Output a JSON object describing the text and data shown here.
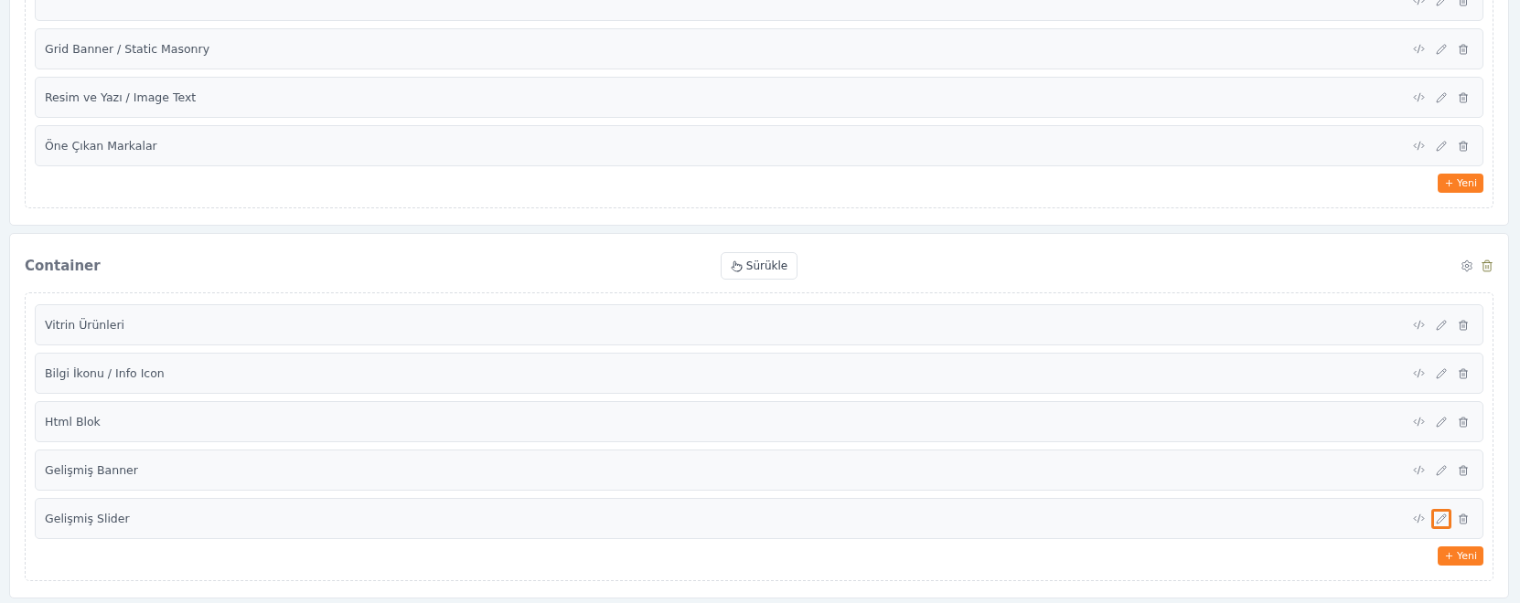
{
  "sections": [
    {
      "blocks": [
        {
          "highlighted": false
        },
        {
          "name": "Grid Banner / Static Masonry",
          "highlighted": false
        },
        {
          "name": "Resim ve Yazı / Image Text",
          "highlighted": false
        },
        {
          "name": "Öne Çıkan Markalar",
          "highlighted": false
        }
      ],
      "add_label": "Yeni"
    },
    {
      "title": "Container",
      "drag_label": "Sürükle",
      "blocks": [
        {
          "name": "Vitrin Ürünleri",
          "highlighted": false
        },
        {
          "name": "Bilgi İkonu / Info Icon",
          "highlighted": false
        },
        {
          "name": "Html Blok",
          "highlighted": false
        },
        {
          "name": "Gelişmiş Banner",
          "highlighted": false
        },
        {
          "name": "Gelişmiş Slider",
          "highlighted": true
        }
      ],
      "add_label": "Yeni"
    }
  ]
}
